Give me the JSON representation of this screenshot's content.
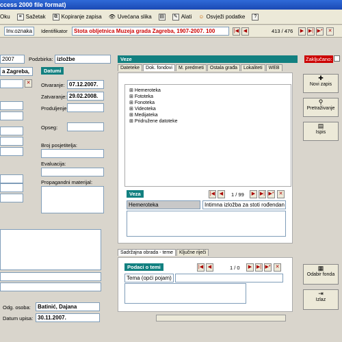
{
  "window": {
    "title": "ccess 2000 file format)"
  },
  "menu": {
    "items": [
      {
        "label": "Oku",
        "icon": "filter-icon"
      },
      {
        "label": "Sažetak",
        "icon": "summary-icon"
      },
      {
        "label": "Kopiranje zapisa",
        "icon": "copy-icon"
      },
      {
        "label": "Uvećana slika",
        "icon": "eye-icon"
      },
      {
        "label": "",
        "icon": "printer-icon"
      },
      {
        "label": "Alati",
        "icon": "tools-icon"
      },
      {
        "label": "Osvježi podatke",
        "icon": "refresh-icon"
      },
      {
        "label": "",
        "icon": "help-icon"
      }
    ]
  },
  "recbar": {
    "field_select": "Inv.oznaka",
    "identifier_label": "Identifikator",
    "identifier_value": "Stota obljetnica Muzeja grada Zagreba, 1907-2007. 100",
    "counter": "413 / 476"
  },
  "left": {
    "year": "2007",
    "subset_label": "Podzbirka:",
    "subset_value": "izložbe",
    "place": "a Zagreba,",
    "datumi_header": "Datumi",
    "otvaranje_label": "Otvaranje:",
    "otvaranje_value": "07.12.2007.",
    "zatvaranje_label": "Zatvaranje:",
    "zatvaranje_value": "29.02.2008.",
    "produljenje_label": "Produljenje:",
    "opseg_label": "Opseg:",
    "posjetitelja_label": "Broj posjetitelja:",
    "evaluacija_label": "Evaluacija:",
    "propagandni_label": "Propagandni materijal:",
    "odg_label": "Odg. osoba:",
    "odg_value": "Batinić, Dajana",
    "datum_upisa_label": "Datum upisa:",
    "datum_upisa_value": "30.11.2007."
  },
  "veze": {
    "header": "Veze",
    "tabs": [
      "Dateteke",
      "Dok. fondovi",
      "M. predmeti",
      "Ostala građa",
      "Lokaliteti",
      "WEB"
    ],
    "active_tab": "Dok. fondovi",
    "tree": [
      "Hemeroteka",
      "Fototeka",
      "Fonoteka",
      "Videoteka",
      "Medijateka",
      "Pridružene datoteke"
    ],
    "veza_header": "Veza",
    "veza_counter": "1 / 99",
    "veza_type": "Hemeroteka",
    "veza_desc": "Intimna izložba za stoti rođendan"
  },
  "bottom": {
    "tabs": [
      "Sadržajna obrada - teme",
      "Ključne riječi"
    ],
    "podaci_header": "Podaci o temi",
    "podaci_counter": "1 / 0",
    "tema_label": "Tema (opći pojam)"
  },
  "right": {
    "zakljucano": "Zaključano:",
    "buttons": [
      "Novi zapis",
      "Pretraživanje",
      "Ispis"
    ],
    "bottom_buttons": [
      "Odabir fonda",
      "Izlaz"
    ]
  }
}
